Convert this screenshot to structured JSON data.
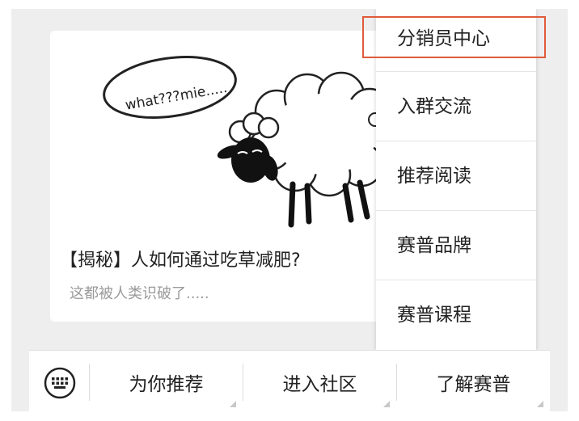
{
  "article": {
    "image_text": "what???mie.....",
    "title": "【揭秘】人如何通过吃草减肥?",
    "description": "这都被人类识破了....."
  },
  "popup_menu": {
    "items": [
      {
        "label": "分销员中心",
        "highlighted": true
      },
      {
        "label": "入群交流"
      },
      {
        "label": "推荐阅读"
      },
      {
        "label": "赛普品牌"
      },
      {
        "label": "赛普课程"
      }
    ]
  },
  "bottom_bar": {
    "keyboard_icon": "keyboard-icon",
    "tabs": [
      {
        "label": "为你推荐"
      },
      {
        "label": "进入社区"
      },
      {
        "label": "了解赛普"
      }
    ]
  },
  "colors": {
    "highlight": "#e05a3a",
    "background": "#eeeeee"
  }
}
